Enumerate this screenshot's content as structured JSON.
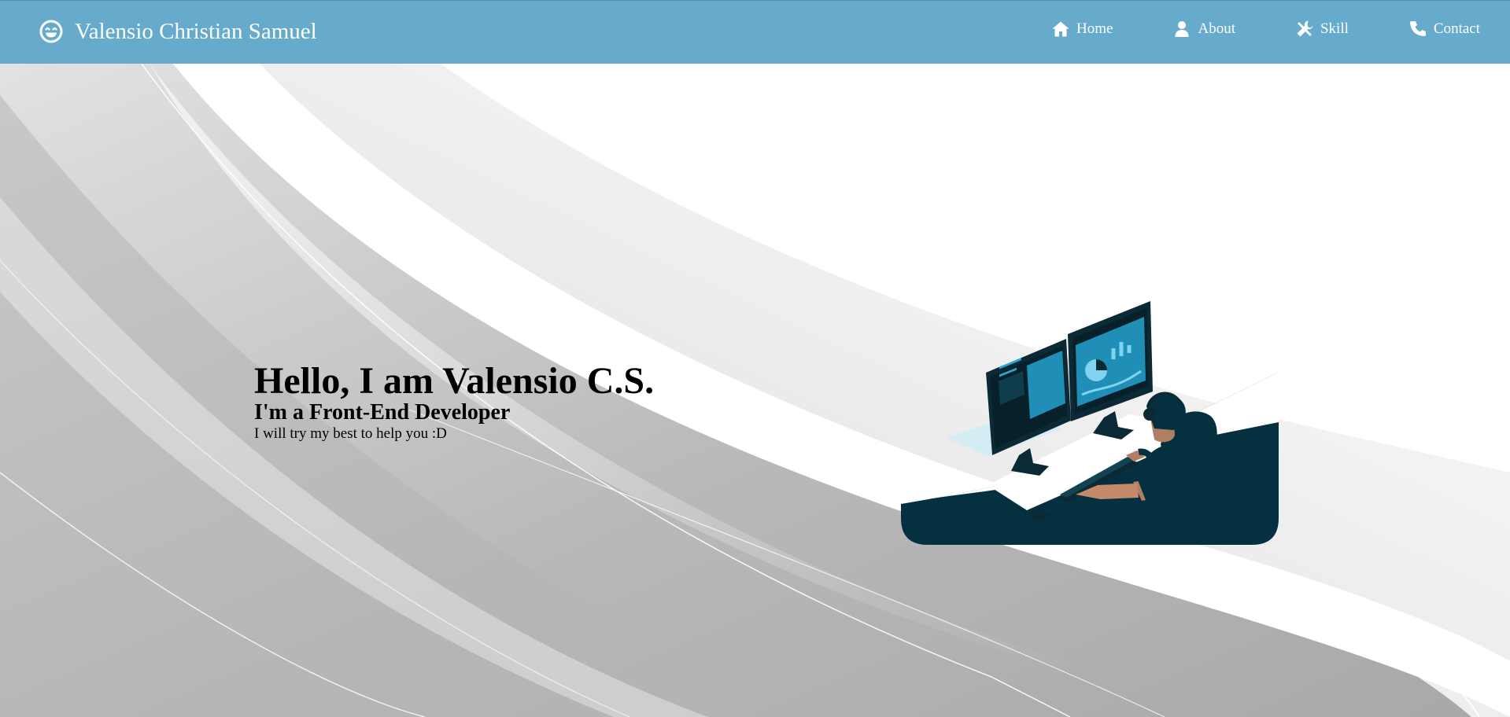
{
  "header": {
    "brand_title": "Valensio Christian Samuel",
    "brand_icon": "laughing-face-icon",
    "nav": [
      {
        "label": "Home",
        "icon": "home-icon"
      },
      {
        "label": "About",
        "icon": "user-icon"
      },
      {
        "label": "Skill",
        "icon": "tools-icon"
      },
      {
        "label": "Contact",
        "icon": "phone-icon"
      }
    ],
    "bar_color": "#66aacc"
  },
  "hero": {
    "heading": "Hello, I am Valensio C.S.",
    "subheading": "I'm a Front-End Developer",
    "tagline": "I will try my best to help you :D",
    "illustration": "developer-at-desk-illustration",
    "illustration_color": "#04303f",
    "accent_color": "#2aa6d4"
  }
}
